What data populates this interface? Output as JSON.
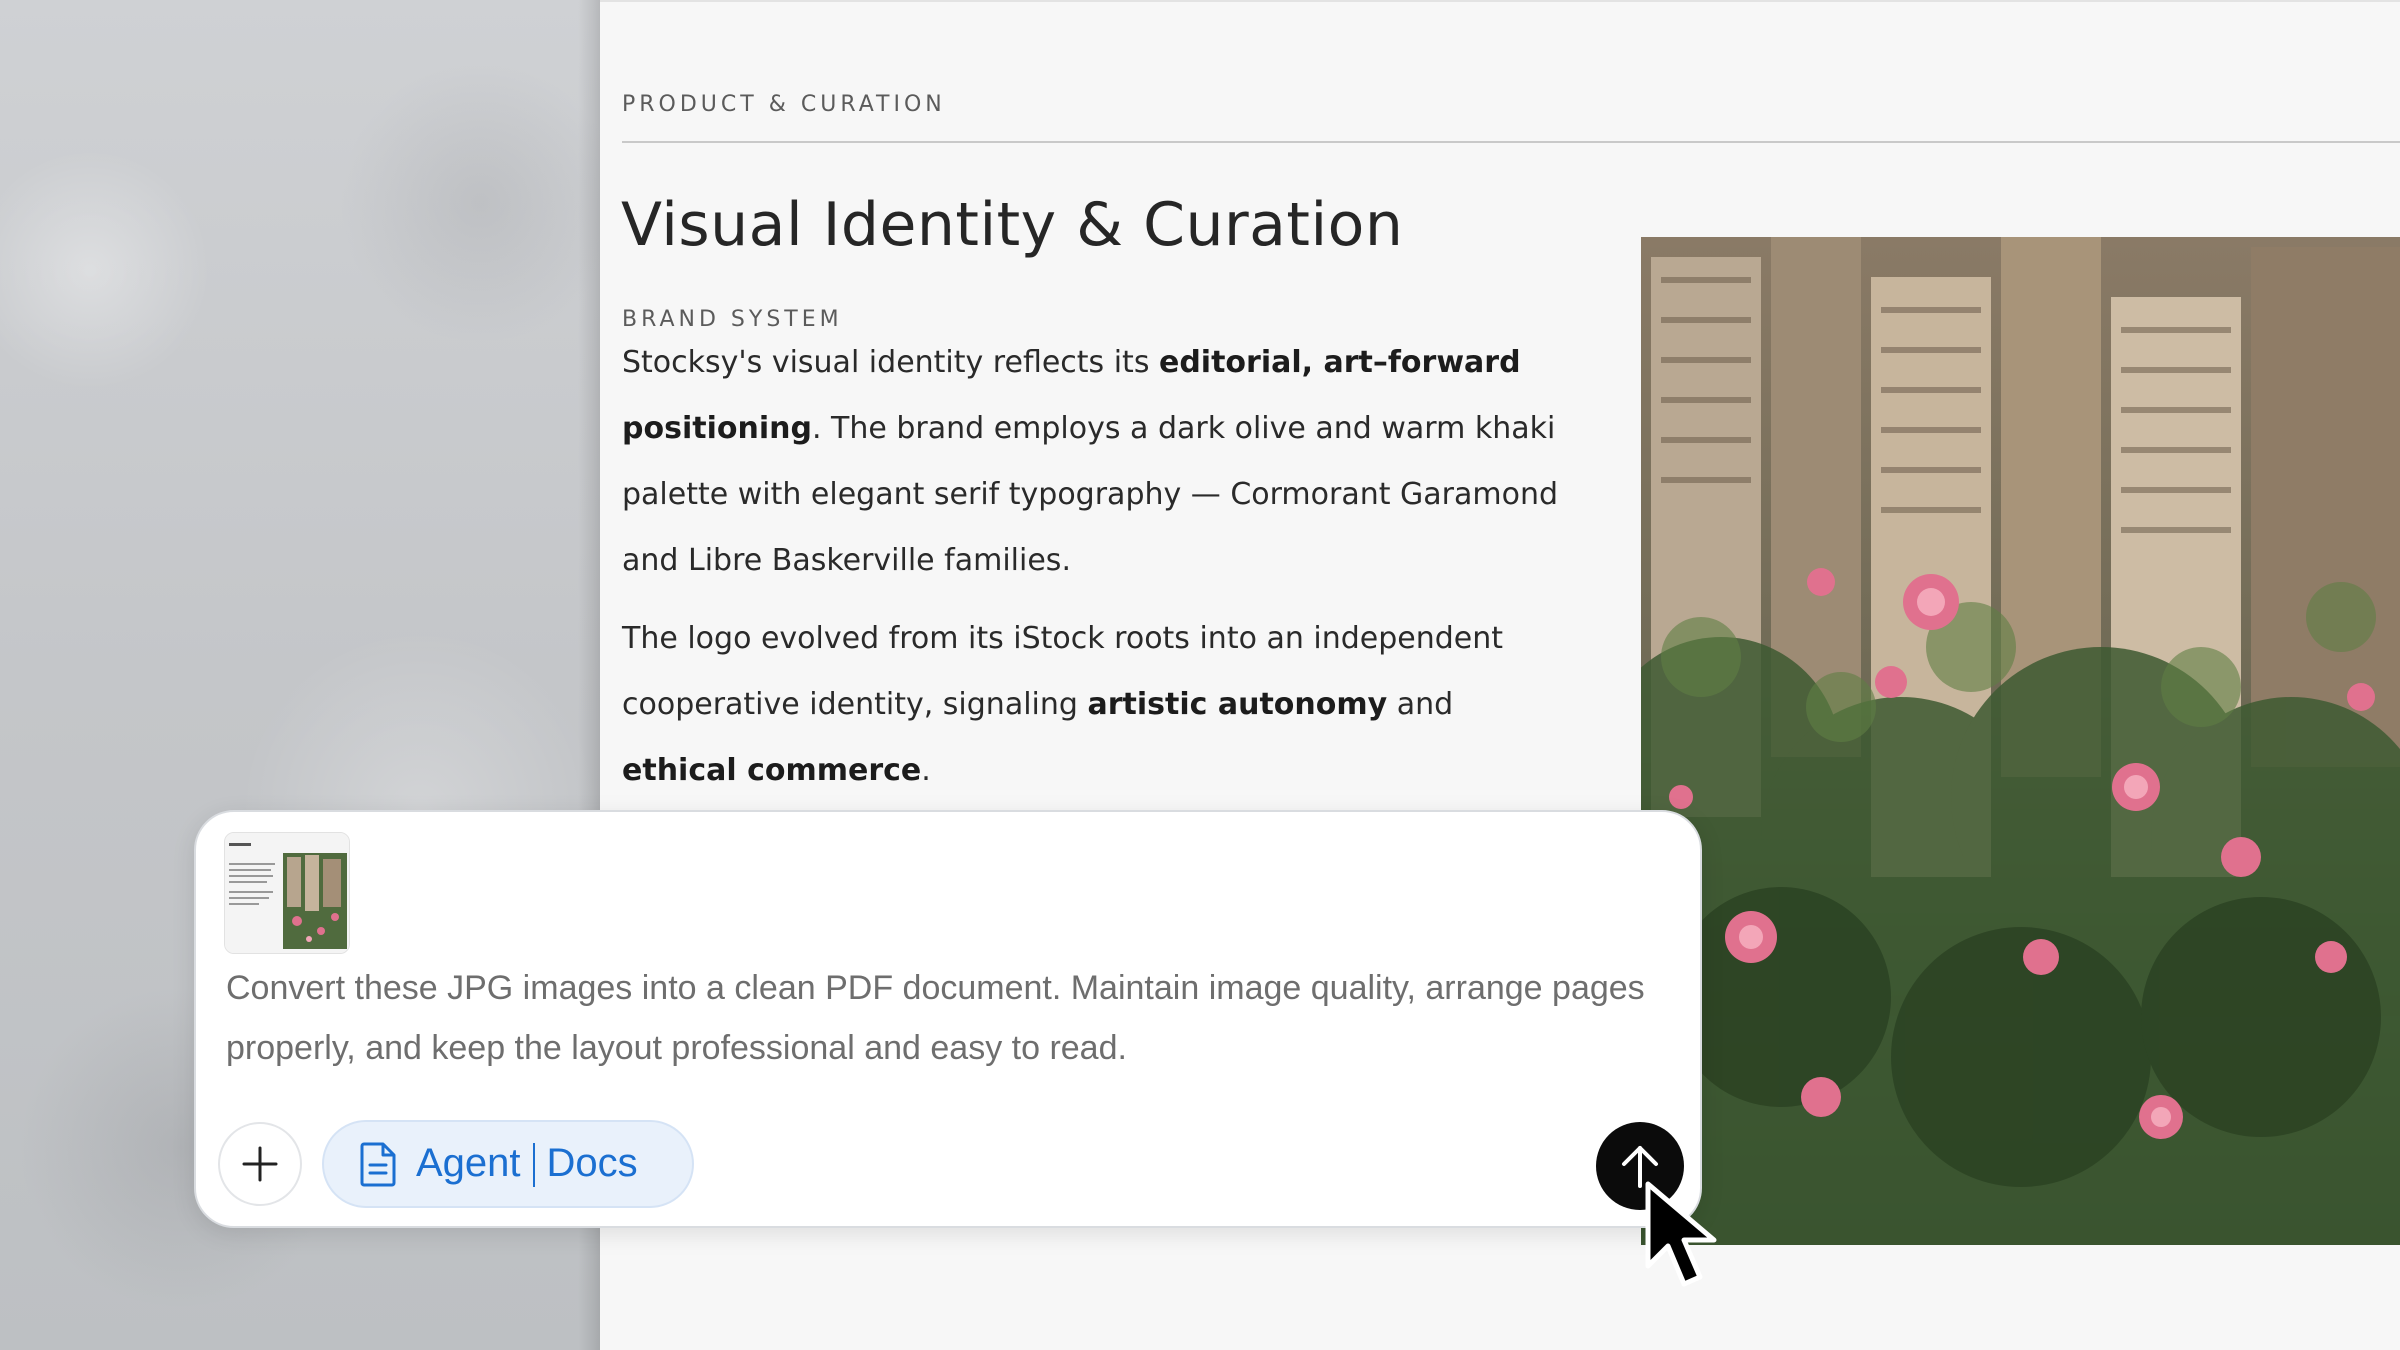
{
  "document": {
    "section_label": "PRODUCT & CURATION",
    "title": "Visual Identity & Curation",
    "sub_label": "BRAND SYSTEM",
    "para1": {
      "t1": "Stocksy's visual identity reflects its ",
      "b1": "editorial, art–forward positioning",
      "t2": ". The brand employs a dark olive and warm khaki palette with elegant serif typography — Cormorant Garamond and Libre Baskerville families."
    },
    "para2": {
      "t1": "The logo evolved from its iStock roots into an independent cooperative identity, signaling ",
      "b1": "artistic autonomy",
      "t2": " and ",
      "b2": "ethical commerce",
      "t3": "."
    },
    "photo_icon": "city-flowers-photo"
  },
  "composer": {
    "attachment_icon": "document-thumbnail",
    "prompt": "Convert these JPG images into a clean PDF document. Maintain image quality, arrange pages properly, and keep the layout professional and easy to read.",
    "add_icon": "plus-icon",
    "agent_chip": {
      "icon": "document-icon",
      "label_left": "Agent",
      "label_right": "Docs"
    },
    "send_icon": "arrow-up-icon"
  },
  "colors": {
    "chip_text": "#1b6fd1",
    "chip_bg": "#e9f1fb",
    "send_bg": "#0b0b0b",
    "page_bg": "#f7f7f7"
  }
}
